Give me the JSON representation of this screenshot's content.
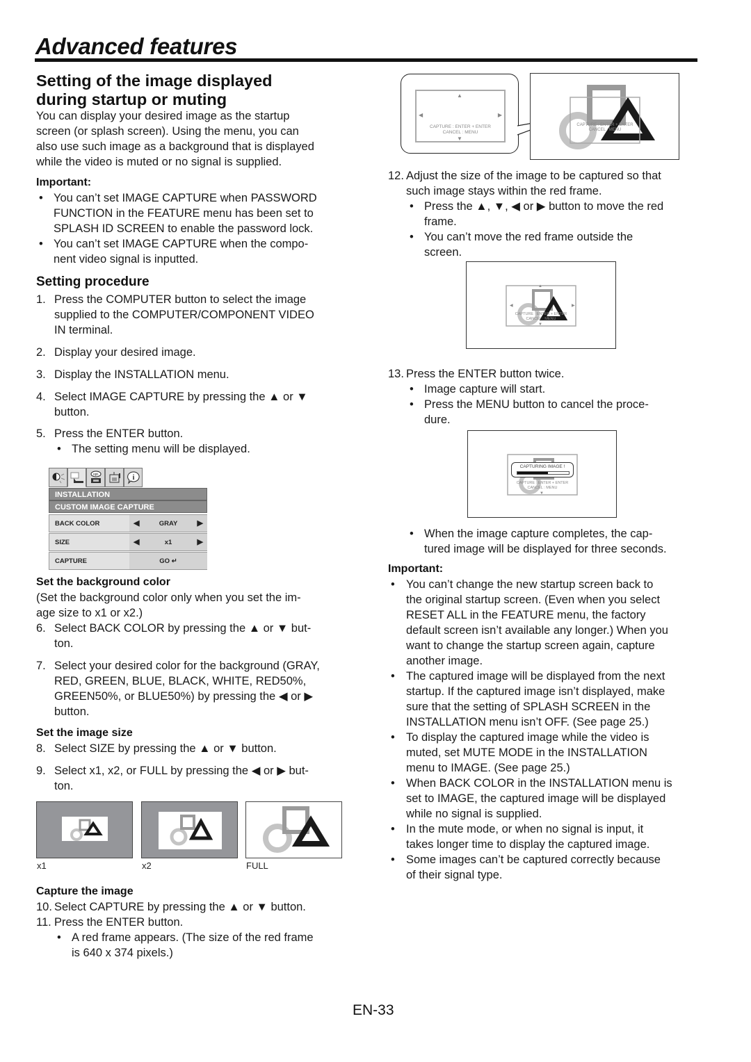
{
  "page": {
    "title": "Advanced features",
    "number": "EN-33"
  },
  "left": {
    "section_title_line1": "Setting of the image displayed",
    "section_title_line2": "during startup or muting",
    "intro": [
      "You can display your desired image as the startup",
      "screen (or splash screen). Using the menu, you can",
      "also use such image as a background that is displayed",
      "while the video is muted or no signal is supplied."
    ],
    "important_label": "Important:",
    "important_items": [
      [
        "You can’t set IMAGE CAPTURE when PASSWORD",
        "FUNCTION in the FEATURE menu has been set to",
        "SPLASH ID SCREEN to enable the password lock."
      ],
      [
        "You can’t set IMAGE CAPTURE when the compo-",
        "nent video signal is inputted."
      ]
    ],
    "procedure_title": "Setting procedure",
    "steps": [
      {
        "num": "1.",
        "lines": [
          "Press the COMPUTER button to select the image",
          "supplied to the COMPUTER/COMPONENT VIDEO",
          "IN terminal."
        ]
      },
      {
        "num": "2.",
        "lines": [
          "Display your desired image."
        ]
      },
      {
        "num": "3.",
        "lines": [
          "Display the INSTALLATION menu."
        ]
      },
      {
        "num": "4.",
        "lines": [
          "Select IMAGE CAPTURE by pressing the ▲ or ▼",
          "button."
        ]
      },
      {
        "num": "5.",
        "lines": [
          "Press the ENTER button."
        ]
      }
    ],
    "step5_bullet": "The setting menu will be displayed.",
    "bg_color_title": "Set the background color",
    "bg_color_note": [
      "(Set the background color only when you set the im-",
      "age size to x1 or x2.)"
    ],
    "steps_b": [
      {
        "num": "6.",
        "lines": [
          "Select BACK COLOR by pressing the ▲ or ▼ but-",
          "ton."
        ]
      },
      {
        "num": "7.",
        "lines": [
          "Select your desired color for the background (GRAY,",
          "RED, GREEN, BLUE, BLACK, WHITE, RED50%,",
          "GREEN50%, or BLUE50%) by pressing the ◀ or ▶",
          "button."
        ]
      }
    ],
    "image_size_title": "Set the image size",
    "steps_c": [
      {
        "num": "8.",
        "lines": [
          "Select SIZE by pressing the ▲ or ▼ button."
        ]
      },
      {
        "num": "9.",
        "lines": [
          "Select x1, x2, or FULL by pressing the ◀ or ▶ but-",
          "ton."
        ]
      }
    ],
    "size_labels": [
      "x1",
      "x2",
      "FULL"
    ],
    "capture_title": "Capture the image",
    "steps_d": [
      {
        "num": "10.",
        "lines": [
          "Select CAPTURE by pressing the ▲ or ▼ button."
        ]
      },
      {
        "num": "11.",
        "lines": [
          "Press the ENTER button."
        ]
      }
    ],
    "step11_bullet": [
      "A red frame appears. (The size of the red frame",
      "is 640 x 374 pixels.)"
    ]
  },
  "osd": {
    "tabs": [
      {
        "icon": "picture-icon",
        "glyph": "◐"
      },
      {
        "icon": "installation-icon",
        "glyph": "▭"
      },
      {
        "icon": "option-icon",
        "glyph": "opt."
      },
      {
        "icon": "feature-icon",
        "glyph": "▤"
      },
      {
        "icon": "info-icon",
        "glyph": "i"
      }
    ],
    "menu_title": "INSTALLATION",
    "submenu_title": "CUSTOM IMAGE CAPTURE",
    "rows": [
      {
        "label": "BACK COLOR",
        "value": "GRAY",
        "has_arrows": true
      },
      {
        "label": "SIZE",
        "value": "x1",
        "has_arrows": true
      },
      {
        "label": "CAPTURE",
        "value": "GO ↵",
        "has_arrows": false
      }
    ],
    "arrow_left": "◀",
    "arrow_right": "▶"
  },
  "right": {
    "frame_text_line1": "CAPTURE : ENTER + ENTER",
    "frame_text_line2": "CANCEL : MENU",
    "capturing_text": "CAPTURING IMAGE !",
    "capture_progress": 0.6,
    "steps": [
      {
        "num": "12.",
        "lines": [
          "Adjust the size of the image to be captured so that",
          "such image stays within the red frame."
        ]
      }
    ],
    "step12_bullets": [
      [
        "Press the ▲, ▼, ◀ or ▶ button to move the red",
        "frame."
      ],
      [
        "You can’t move the red frame outside the",
        "screen."
      ]
    ],
    "step13": {
      "num": "13.",
      "line": "Press the ENTER button twice."
    },
    "step13_bullets": [
      [
        "Image capture will start."
      ],
      [
        "Press the MENU button to cancel the proce-",
        "dure."
      ]
    ],
    "complete_bullet": [
      "When the image capture completes, the cap-",
      "tured image will be displayed for three seconds."
    ],
    "important_label": "Important:",
    "important_items": [
      [
        "You can’t change the new startup screen back to",
        "the original startup screen. (Even when you select",
        "RESET ALL in the FEATURE menu, the factory",
        "default screen isn’t available any longer.) When you",
        "want to change the startup screen again, capture",
        "another image."
      ],
      [
        "The captured image will be displayed from the next",
        "startup. If the captured image isn’t displayed, make",
        "sure that the setting of SPLASH SCREEN in the",
        "INSTALLATION menu isn’t OFF. (See page 25.)"
      ],
      [
        "To display the captured image while the video is",
        "muted, set MUTE MODE in the INSTALLATION",
        "menu to IMAGE. (See page 25.)"
      ],
      [
        "When BACK COLOR in the INSTALLATION menu is",
        "set to IMAGE, the captured image will be displayed",
        "while no signal is supplied."
      ],
      [
        "In the mute mode, or when no signal is input, it",
        "takes longer time to display the captured image."
      ],
      [
        "Some images can’t be captured correctly because",
        "of their signal type."
      ]
    ]
  },
  "colors": {
    "text": "#1a1a1a",
    "osd_bar": "#8c8c8c",
    "thumb_bg": "#95969a",
    "circle": "#c4c4c4",
    "square": "#9a9a9a",
    "triangle": "#1a1a1a"
  }
}
